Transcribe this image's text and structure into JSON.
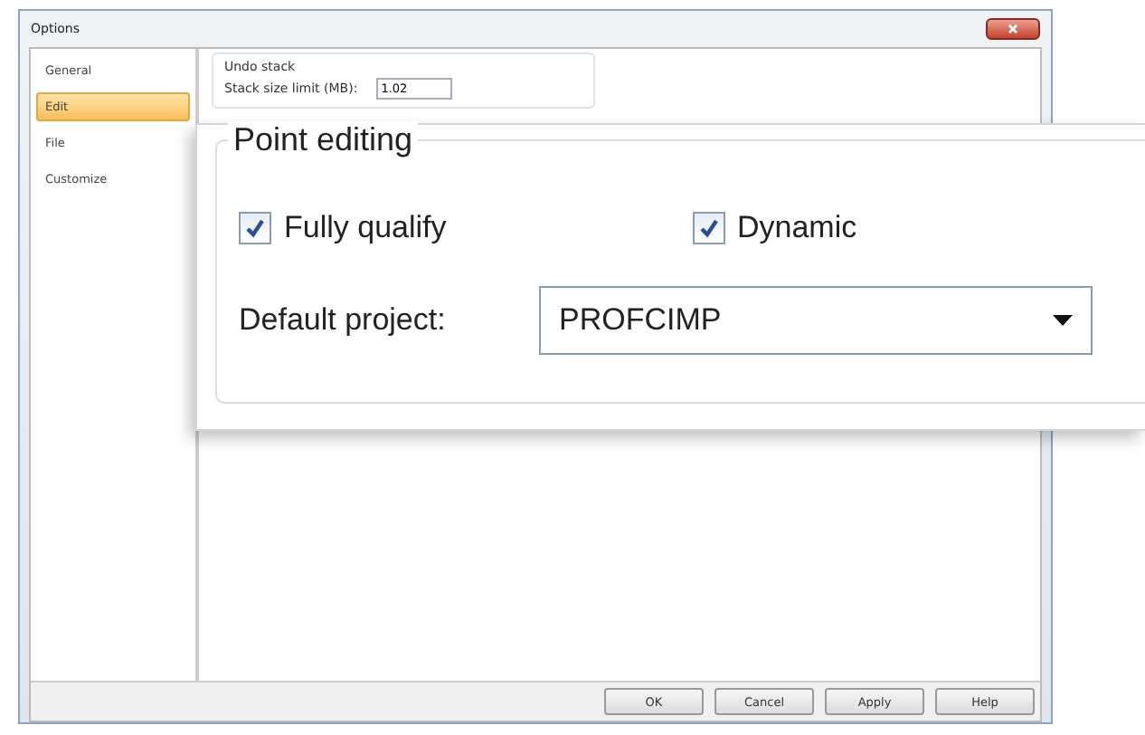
{
  "window": {
    "title": "Options"
  },
  "sidebar": {
    "items": [
      {
        "label": "General",
        "selected": false
      },
      {
        "label": "Edit",
        "selected": true
      },
      {
        "label": "File",
        "selected": false
      },
      {
        "label": "Customize",
        "selected": false
      }
    ]
  },
  "undo_stack": {
    "title": "Undo stack",
    "label": "Stack size limit (MB):",
    "value": "1.02"
  },
  "point_editing": {
    "title": "Point editing",
    "checkboxes": [
      {
        "label": "Fully qualify",
        "checked": true
      },
      {
        "label": "Dynamic",
        "checked": true
      }
    ],
    "default_project": {
      "label": "Default project:",
      "value": "PROFCIMP"
    }
  },
  "buttons": [
    "OK",
    "Cancel",
    "Apply",
    "Help"
  ]
}
